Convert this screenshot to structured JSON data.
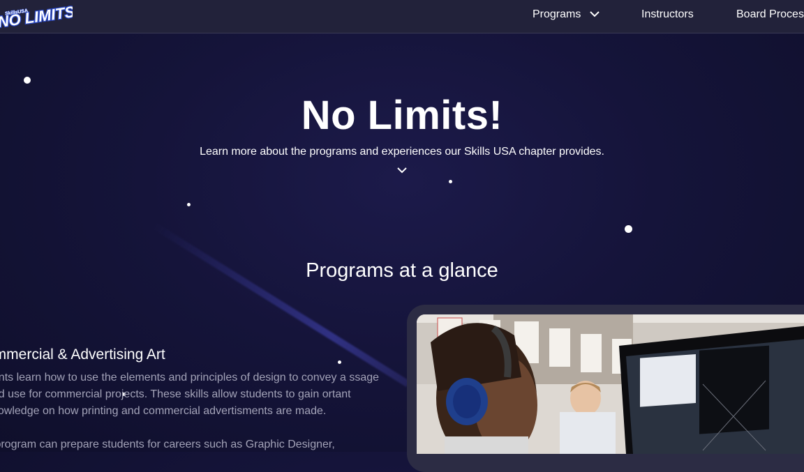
{
  "nav": {
    "logo_text": "NO LIMITS",
    "logo_small": "SkillsUSA",
    "items": [
      {
        "label": "Programs"
      },
      {
        "label": "Instructors"
      },
      {
        "label": "Board Proces"
      }
    ]
  },
  "hero": {
    "title": "No Limits!",
    "subtitle": "Learn more about the programs and experiences our Skills USA chapter provides."
  },
  "section": {
    "title": "Programs at a glance"
  },
  "program": {
    "title": "ommercial & Advertising Art",
    "description": "dents learn how to use the elements and principles of design to convey a ssage and use for commercial projects. These skills allow students to gain ortant knowledge on how printing and commercial advertisments are made.",
    "description2": "s program can prepare students for careers such as Graphic Designer,"
  },
  "colors": {
    "background": "#15143a",
    "nav": "#22223a",
    "muted_text": "#a3a3b8"
  },
  "icons": [
    "logo",
    "chevron-down-icon"
  ]
}
